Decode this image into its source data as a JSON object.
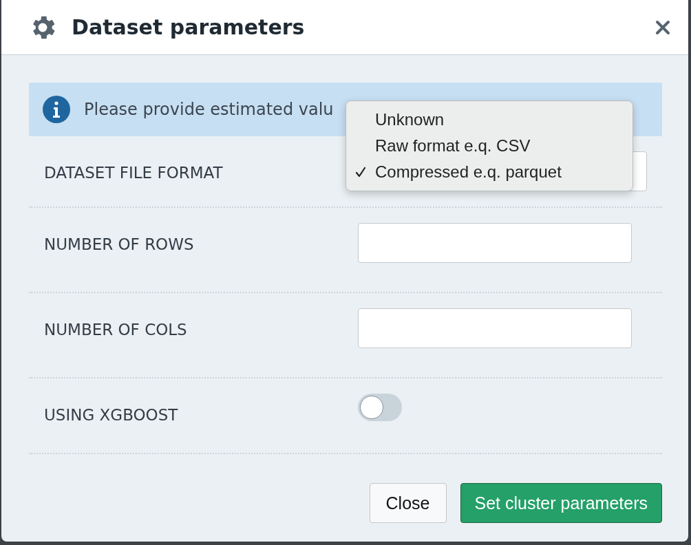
{
  "dialog": {
    "title": "Dataset parameters"
  },
  "alert": {
    "text": "Please provide estimated valu"
  },
  "fields": [
    {
      "kind": "select",
      "label": "DATASET FILE FORMAT",
      "menu_open": true,
      "options": [
        {
          "label": "Unknown",
          "selected": false
        },
        {
          "label": "Raw format e.q. CSV",
          "selected": false
        },
        {
          "label": "Compressed e.q. parquet",
          "selected": true
        }
      ]
    },
    {
      "kind": "text",
      "label": "NUMBER OF ROWS"
    },
    {
      "kind": "text",
      "label": "NUMBER OF COLS"
    },
    {
      "kind": "toggle",
      "label": "USING XGBOOST",
      "on": false
    }
  ],
  "buttons": [
    {
      "label": "Close",
      "kind": "secondary"
    },
    {
      "label": "Set cluster parameters",
      "kind": "primary"
    }
  ]
}
